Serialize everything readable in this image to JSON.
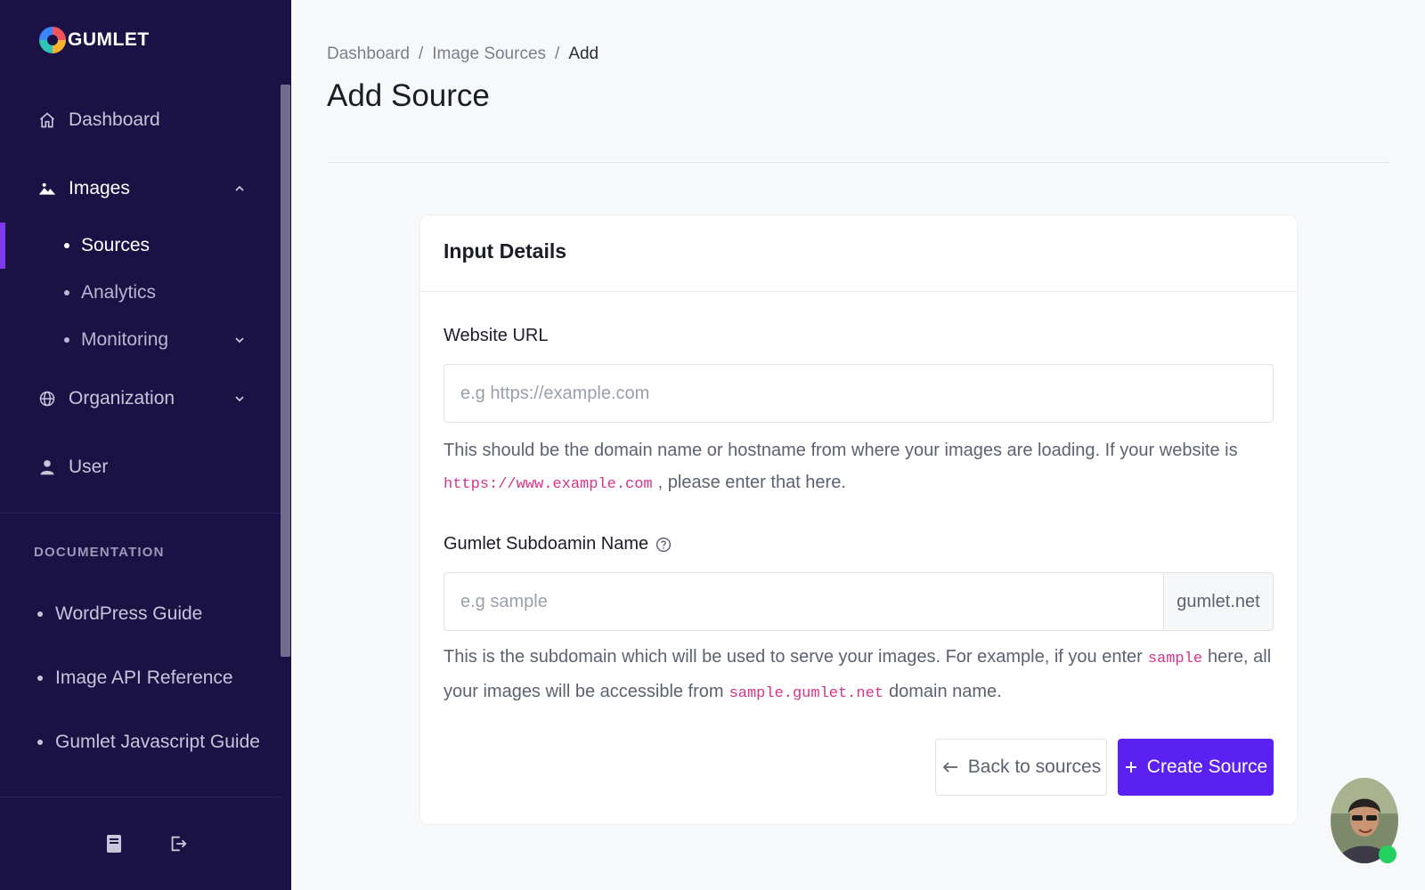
{
  "brand": {
    "name": "GUMLET"
  },
  "sidebar": {
    "nav": [
      {
        "label": "Dashboard",
        "icon": "home-icon"
      },
      {
        "label": "Images",
        "icon": "image-icon"
      },
      {
        "label": "Organization",
        "icon": "globe-icon"
      },
      {
        "label": "User",
        "icon": "user-icon"
      }
    ],
    "images_sub": [
      {
        "label": "Sources"
      },
      {
        "label": "Analytics"
      },
      {
        "label": "Monitoring"
      }
    ],
    "documentation": {
      "heading": "DOCUMENTATION",
      "items": [
        {
          "label": "WordPress Guide"
        },
        {
          "label": "Image API Reference"
        },
        {
          "label": "Gumlet Javascript Guide"
        }
      ]
    },
    "footer_icons": [
      "book-icon",
      "logout-icon"
    ]
  },
  "breadcrumb": {
    "items": [
      "Dashboard",
      "Image Sources",
      "Add"
    ],
    "separator": "/"
  },
  "page": {
    "title": "Add Source"
  },
  "card": {
    "title": "Input Details",
    "website_url": {
      "label": "Website URL",
      "placeholder": "e.g https://example.com",
      "value": "",
      "help_before": "This should be the domain name or hostname from where your images are loading. If your website is",
      "help_code": "https://www.example.com",
      "help_after": ", please enter that here."
    },
    "subdomain": {
      "label": "Gumlet Subdoamin Name",
      "placeholder": "e.g sample",
      "value": "",
      "addon": "gumlet.net",
      "help_part1": "This is the subdomain which will be used to serve your images. For example, if you enter",
      "help_code1": "sample",
      "help_part2": "here, all your images will be accessible from",
      "help_code2": "sample.gumlet.net",
      "help_part3": "domain name."
    },
    "buttons": {
      "back": "Back to sources",
      "create": "Create Source"
    }
  },
  "colors": {
    "sidebar_bg": "#1a1244",
    "accent": "#5b21f0",
    "code": "#d6338a",
    "online": "#23d160"
  }
}
